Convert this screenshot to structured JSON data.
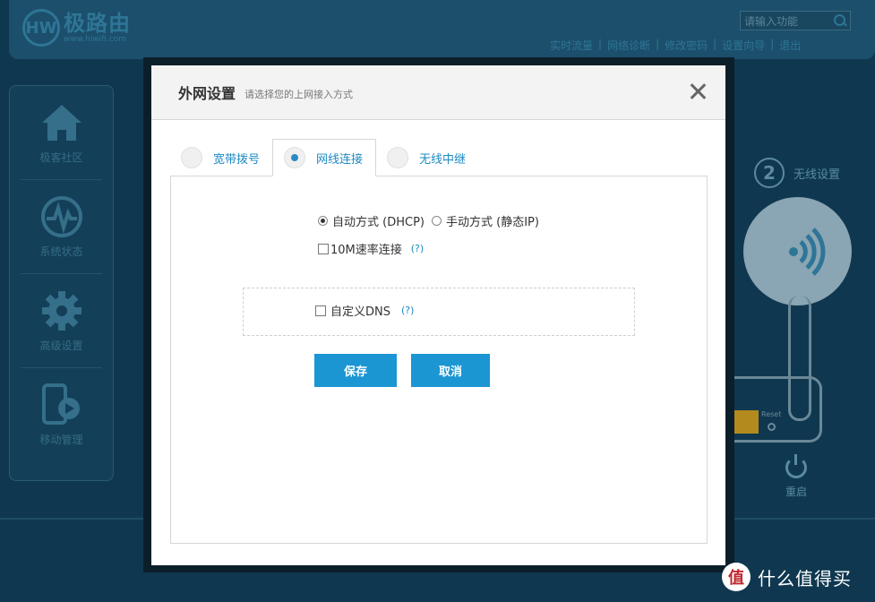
{
  "header": {
    "logo_mark": "HW",
    "logo_text": "极路由",
    "logo_url": "www.hiwifi.com",
    "search_placeholder": "请输入功能",
    "links": [
      "实时流量",
      "网络诊断",
      "修改密码",
      "设置向导",
      "退出"
    ],
    "separator": "|"
  },
  "sidebar": {
    "items": [
      {
        "label": "极客社区",
        "icon": "home-icon"
      },
      {
        "label": "系统状态",
        "icon": "pulse-icon"
      },
      {
        "label": "高级设置",
        "icon": "gear-icon"
      },
      {
        "label": "移动管理",
        "icon": "mobile-icon"
      }
    ]
  },
  "background": {
    "step_number": "2",
    "step_label": "无线设置",
    "reset_label": "Reset",
    "reboot_label": "重启"
  },
  "modal": {
    "title": "外网设置",
    "subtitle": "请选择您的上网接入方式",
    "tabs": [
      {
        "label": "宽带拨号",
        "selected": false
      },
      {
        "label": "网线连接",
        "selected": true
      },
      {
        "label": "无线中继",
        "selected": false
      }
    ],
    "mode_auto": "自动方式 (DHCP)",
    "mode_manual": "手动方式 (静态IP)",
    "speed_label": "10M速率连接",
    "help": "(?)",
    "dns_label": "自定义DNS",
    "save_label": "保存",
    "cancel_label": "取消"
  },
  "watermark": {
    "logo": "值",
    "text": "什么值得买"
  },
  "colors": {
    "accent": "#1b96d3",
    "link": "#1d8ac2",
    "background": "#0f3850"
  }
}
